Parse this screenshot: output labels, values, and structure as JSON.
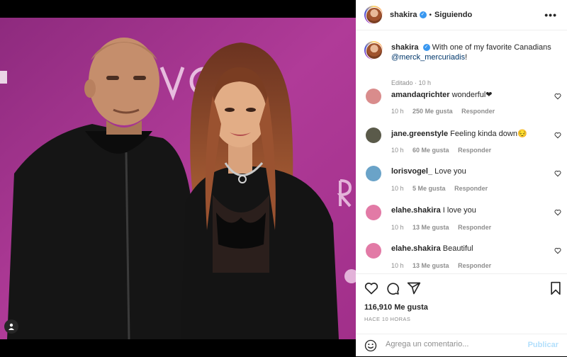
{
  "post_header": {
    "username": "shakira",
    "separator": "•",
    "follow_status": "Siguiendo",
    "more": "•••"
  },
  "caption": {
    "username": "shakira",
    "text": "With one of my favorite Canadians",
    "mention": "@merck_mercuriadis",
    "suffix": "!",
    "meta": "Editado · 10 h"
  },
  "comments": [
    {
      "username": "amandaqrichter",
      "text": "wonderful❤",
      "time": "10 h",
      "likes": "250 Me gusta",
      "reply": "Responder",
      "avatar_color": "#d98c8c"
    },
    {
      "username": "jane.greenstyle",
      "text": "Feeling kinda down😔",
      "time": "10 h",
      "likes": "60 Me gusta",
      "reply": "Responder",
      "avatar_color": "#5a5a4a"
    },
    {
      "username": "lorisvogel_",
      "text": "Love you",
      "time": "10 h",
      "likes": "5 Me gusta",
      "reply": "Responder",
      "avatar_color": "#6aa3c8"
    },
    {
      "username": "elahe.shakira",
      "text": "I love you",
      "time": "10 h",
      "likes": "13 Me gusta",
      "reply": "Responder",
      "avatar_color": "#e27aa6"
    },
    {
      "username": "elahe.shakira",
      "text": "Beautiful",
      "time": "10 h",
      "likes": "13 Me gusta",
      "reply": "Responder",
      "avatar_color": "#e27aa6"
    }
  ],
  "likes_count": "116,910 Me gusta",
  "posted_ago": "HACE 10 HORAS",
  "add_comment": {
    "placeholder": "Agrega un comentario...",
    "publish": "Publicar"
  },
  "icons": [
    "heart-icon",
    "comment-icon",
    "share-icon",
    "bookmark-icon",
    "emoji-icon",
    "tag-user-icon",
    "more-options-icon"
  ],
  "colors": {
    "backdrop": "#a0338c",
    "link": "#00376b",
    "verified": "#3897f0",
    "publish_disabled": "#b2dffc",
    "muted": "#8e8e8e"
  }
}
